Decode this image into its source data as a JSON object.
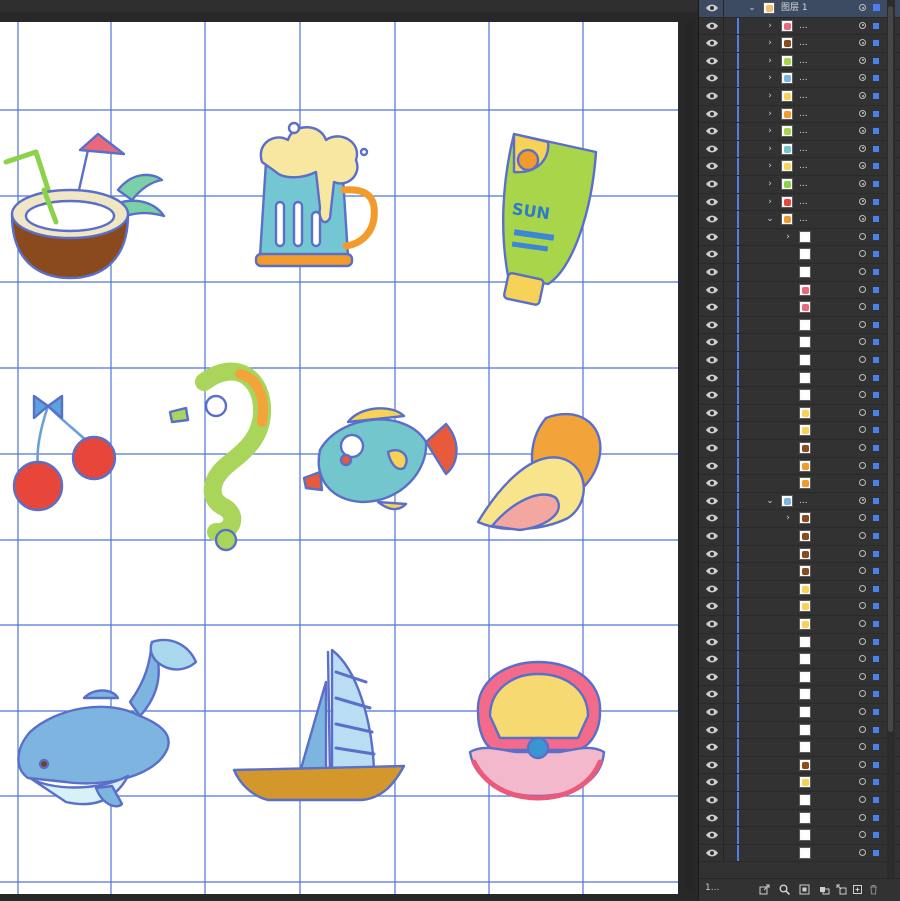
{
  "colors": {
    "grid": "#4f74d9",
    "path": "#5a6fc9",
    "panel_bg": "#323232",
    "selection_blue": "#4a7ff0",
    "top_row": "#3c4b62"
  },
  "layers": {
    "top_layer_name": "图层 1",
    "child_name": "...",
    "footer_label": "1...",
    "footer_icons": [
      "export-icon",
      "search-icon",
      "collect-icon",
      "make-clipping-mask-icon",
      "move-to-layer-icon",
      "new-layer-icon",
      "delete-icon"
    ]
  },
  "artboard": {
    "illustrations": [
      "coconut-drink",
      "beer-mug",
      "sunscreen-tube",
      "cherries",
      "seahorse",
      "fish",
      "seashell",
      "dolphin",
      "sailboat",
      "pearl-clam"
    ],
    "tube_label": "SUN"
  }
}
